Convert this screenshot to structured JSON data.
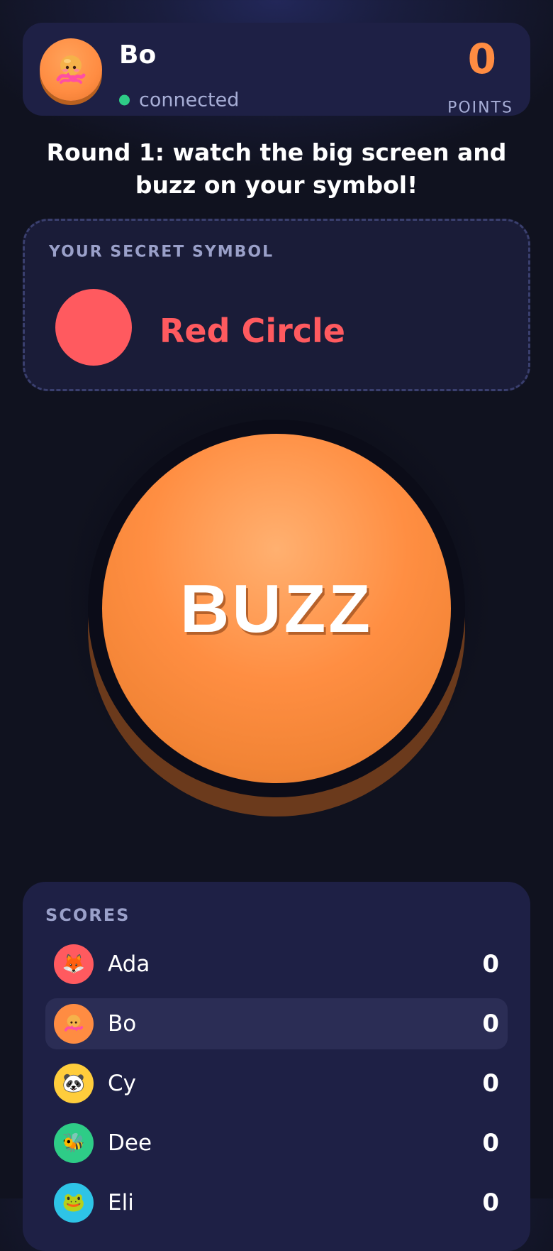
{
  "player": {
    "name": "Bo",
    "status": "connected",
    "points": "0",
    "points_label": "POINTS",
    "avatar_icon": "octopus-icon",
    "avatar_color": "#ff8c42"
  },
  "round": {
    "instruction": "Round 1: watch the big screen and buzz on your symbol!"
  },
  "symbol": {
    "title": "YOUR SECRET SYMBOL",
    "name": "Red Circle",
    "shape": "circle",
    "color": "#ff5a5f"
  },
  "buzz": {
    "label": "BUZZ",
    "color": "#ff8c42"
  },
  "scores": {
    "title": "SCORES",
    "players": [
      {
        "name": "Ada",
        "score": "0",
        "icon": "fox-icon",
        "color": "#ff5a5f",
        "current": false
      },
      {
        "name": "Bo",
        "score": "0",
        "icon": "octopus-icon",
        "color": "#ff8c42",
        "current": true
      },
      {
        "name": "Cy",
        "score": "0",
        "icon": "panda-icon",
        "color": "#ffcd3c",
        "current": false
      },
      {
        "name": "Dee",
        "score": "0",
        "icon": "bee-icon",
        "color": "#2ecc87",
        "current": false
      },
      {
        "name": "Eli",
        "score": "0",
        "icon": "animal-icon",
        "color": "#2ec4e6",
        "current": false
      }
    ]
  },
  "colors": {
    "background": "#10121f",
    "card": "#1e2045",
    "accent": "#ff8c42",
    "connected": "#2ecc87"
  }
}
